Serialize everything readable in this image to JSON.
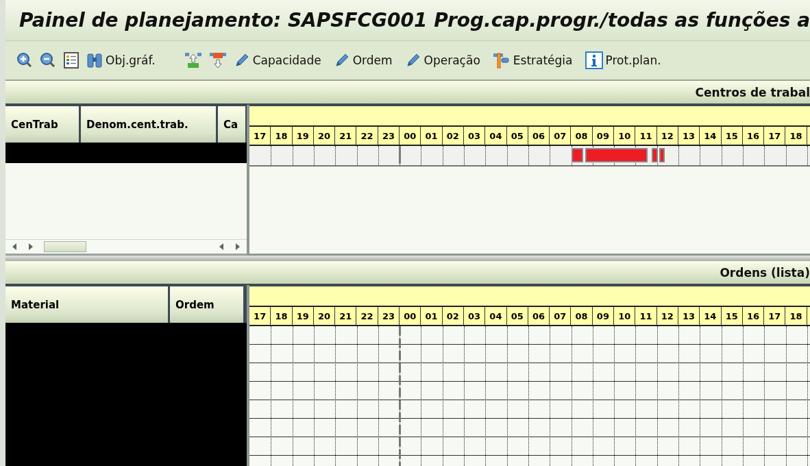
{
  "window": {
    "title": "Painel de planejamento: SAPSFCG001 Prog.cap.progr./todas as funções a"
  },
  "toolbar": [
    {
      "kind": "icon"
    },
    {
      "kind": "icon"
    },
    {
      "kind": "icon"
    },
    {
      "kind": "labeled",
      "label": "Obj.gráf."
    },
    {
      "kind": "icon"
    },
    {
      "kind": "icon"
    },
    {
      "kind": "labeled",
      "label": "Capacidade"
    },
    {
      "kind": "labeled",
      "label": "Ordem"
    },
    {
      "kind": "labeled",
      "label": "Operação"
    },
    {
      "kind": "labeled",
      "label": "Estratégia"
    },
    {
      "kind": "labeled",
      "label": "Prot.plan."
    }
  ],
  "workcenters_panel": {
    "title": "Centros de trabal",
    "columns": [
      "CenTrab",
      "Denom.cent.trab.",
      "Ca"
    ],
    "hours": [
      "17",
      "18",
      "19",
      "20",
      "21",
      "22",
      "23",
      "00",
      "01",
      "02",
      "03",
      "04",
      "05",
      "06",
      "07",
      "08",
      "09",
      "10",
      "11",
      "12",
      "13",
      "14",
      "15",
      "16",
      "17",
      "18"
    ]
  },
  "orders_panel": {
    "title": "Ordens (lista)",
    "columns": [
      "Material",
      "Ordem"
    ],
    "hours": [
      "17",
      "18",
      "19",
      "20",
      "21",
      "22",
      "23",
      "00",
      "01",
      "02",
      "03",
      "04",
      "05",
      "06",
      "07",
      "08",
      "09",
      "10",
      "11",
      "12",
      "13",
      "14",
      "15",
      "16",
      "17",
      "18"
    ]
  }
}
